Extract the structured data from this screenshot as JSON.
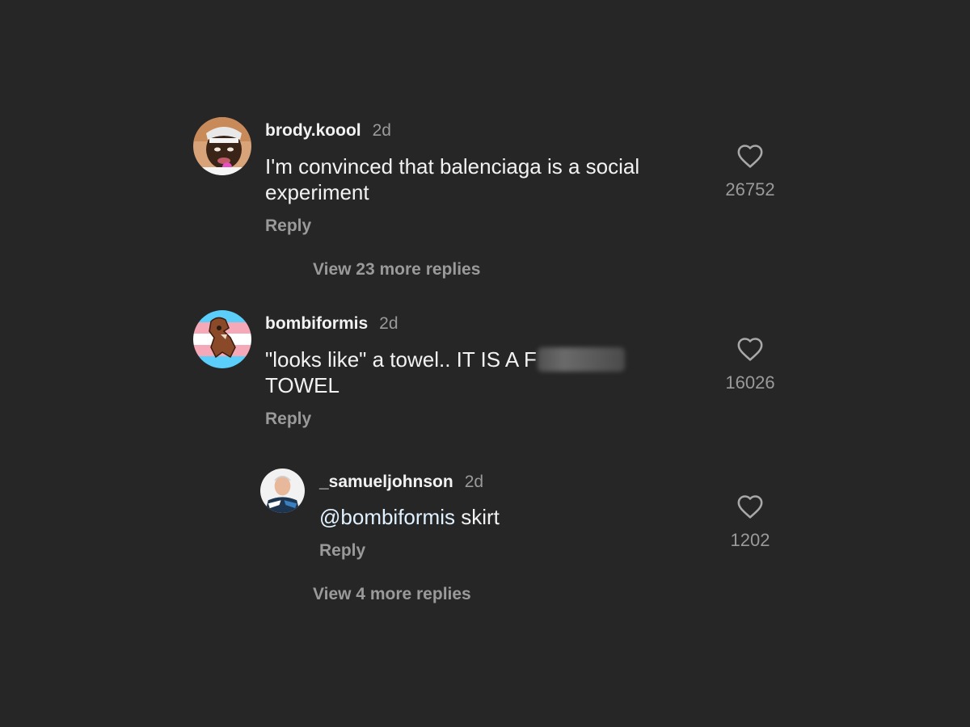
{
  "comments": [
    {
      "username": "brody.koool",
      "time": "2d",
      "text": "I'm convinced that balenciaga is a social experiment",
      "reply_label": "Reply",
      "likes": "26752",
      "avatar_icon": "profile-photo-icon",
      "view_more": "View 23 more replies"
    },
    {
      "username": "bombiformis",
      "time": "2d",
      "text_before_blur": "\"looks like\" a towel.. IT IS A F",
      "text_after_blur": "TOWEL",
      "reply_label": "Reply",
      "likes": "16026",
      "avatar_icon": "profile-photo-icon",
      "replies": [
        {
          "username": "_samueljohnson",
          "time": "2d",
          "mention": "@bombiformis",
          "text": "skirt",
          "reply_label": "Reply",
          "likes": "1202",
          "avatar_icon": "profile-photo-icon"
        }
      ],
      "view_more": "View 4 more replies"
    }
  ],
  "icons": {
    "like": "heart-outline-icon"
  },
  "colors": {
    "background": "#262626",
    "primary_text": "#f2f2f2",
    "secondary_text": "#9a9a9a",
    "mention": "#e0f1ff"
  }
}
